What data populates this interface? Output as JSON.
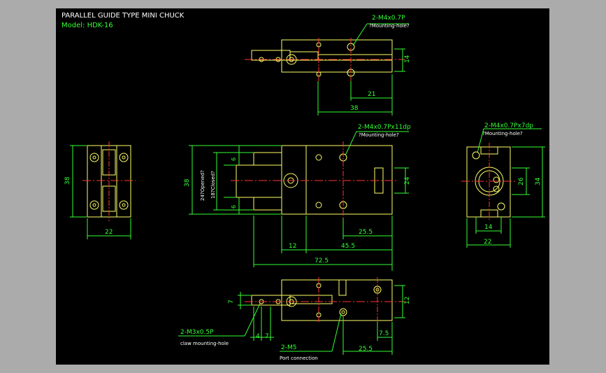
{
  "header": {
    "title": "PARALLEL GUIDE TYPE MINI CHUCK",
    "model": "Model:  HDK-16"
  },
  "views": {
    "top": {
      "callout": "2-M4x0.7P",
      "callout_sub": "?Mounting-hole?",
      "dims": [
        "14",
        "21",
        "38"
      ]
    },
    "left": {
      "dims": [
        "38",
        "22"
      ]
    },
    "front": {
      "callout": "2-M4x0.7Px11dp",
      "callout_sub": "?Mounting-hole?",
      "dims": [
        "38",
        "24?Opened?",
        "18?Closed?",
        "6",
        "6",
        "24",
        "25.5",
        "12",
        "45.5",
        "72.5"
      ]
    },
    "right": {
      "callout": "2-M4x0.7Px7dp",
      "callout_sub": "?Mounting-hole?",
      "dims": [
        "26",
        "34",
        "14",
        "22"
      ]
    },
    "bottom": {
      "callout_claw": "2-M3x0.5P",
      "callout_claw_sub": "claw mounting-hole",
      "callout_port": "2-M5",
      "callout_port_sub": "Port connection",
      "dims": [
        "7",
        "12",
        "4",
        "7",
        "7.5",
        "25.5"
      ]
    }
  },
  "colors": {
    "background": "#000000",
    "frame": "#ababab",
    "part": "#ffff66",
    "dimension": "#33ff33",
    "text": "#ffffff",
    "centerline": "#ff3333"
  }
}
